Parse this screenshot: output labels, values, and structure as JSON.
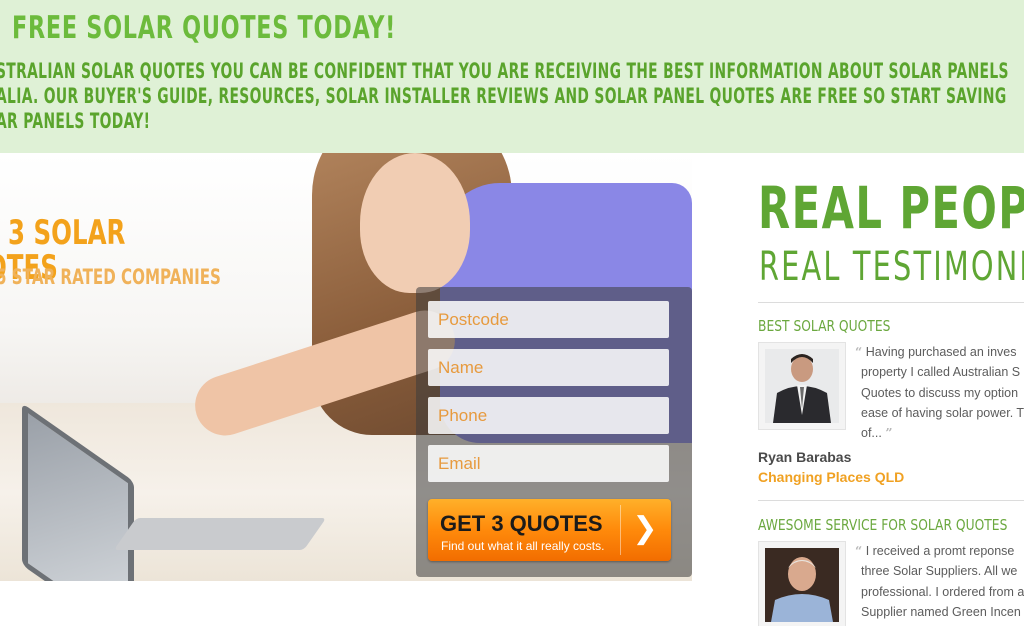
{
  "banner": {
    "title": "FREE SOLAR QUOTES TODAY!",
    "lines": [
      "STRALIAN SOLAR QUOTES YOU CAN BE CONFIDENT THAT YOU ARE RECEIVING THE BEST INFORMATION ABOUT SOLAR PANELS",
      "ALIA. OUR BUYER'S GUIDE, RESOURCES, SOLAR INSTALLER REVIEWS AND SOLAR PANEL QUOTES ARE FREE SO START SAVING",
      "AR PANELS TODAY!"
    ],
    "background": "#dff1d6",
    "accent": "#6cbb3c"
  },
  "hero": {
    "headline_line1": "3 SOLAR",
    "headline_line2": "OTES",
    "subheadline": "5 STAR RATED COMPANIES",
    "accent": "#f3a21b"
  },
  "form": {
    "postcode_placeholder": "Postcode",
    "name_placeholder": "Name",
    "phone_placeholder": "Phone",
    "email_placeholder": "Email",
    "submit_label": "GET 3 QUOTES",
    "submit_sublabel": "Find out what it all really costs.",
    "submit_icon": "chevron-right-icon",
    "submit_color": "#ff8a0b"
  },
  "testimonials": {
    "title": "REAL PEOPLE",
    "subtitle": "REAL TESTIMONIA",
    "items": [
      {
        "heading": "BEST SOLAR QUOTES",
        "quote_lines": [
          "Having purchased an inves",
          "property I called Australian S",
          "Quotes to discuss my option",
          "ease of having solar power. T",
          "of..."
        ],
        "name": "Ryan Barabas",
        "company": "Changing Places QLD"
      },
      {
        "heading": "AWESOME SERVICE FOR SOLAR QUOTES",
        "quote_lines": [
          "I received a promt reponse",
          "three Solar Suppliers. All we",
          "professional. I ordered from a",
          "Supplier named Green Incen"
        ],
        "name": "",
        "company": ""
      }
    ],
    "accent": "#5fa634",
    "company_color": "#f0a122"
  }
}
